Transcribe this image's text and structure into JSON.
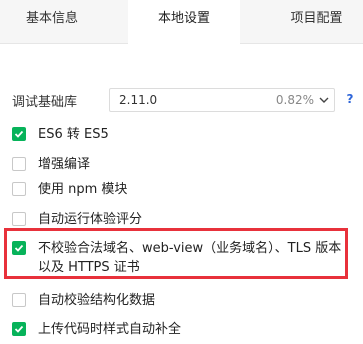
{
  "tabs": [
    {
      "label": "基本信息",
      "active": false
    },
    {
      "label": "本地设置",
      "active": true
    },
    {
      "label": "项目配置",
      "active": false
    }
  ],
  "base_library": {
    "label": "调试基础库",
    "version": "2.11.0",
    "percent": "0.82%",
    "help": "?"
  },
  "options": [
    {
      "label": "ES6 转 ES5",
      "checked": true
    },
    {
      "label": "增强编译",
      "checked": false
    },
    {
      "label": "使用 npm 模块",
      "checked": false
    },
    {
      "label": "自动运行体验评分",
      "checked": false
    },
    {
      "label": "不校验合法域名、web-view（业务域名）、TLS 版本以及 HTTPS 证书",
      "checked": true
    },
    {
      "label": "自动校验结构化数据",
      "checked": false
    },
    {
      "label": "上传代码时样式自动补全",
      "checked": true
    }
  ],
  "colors": {
    "accent_green": "#07b35a",
    "highlight_red": "#e8313b",
    "help_blue": "#2f66d9"
  }
}
